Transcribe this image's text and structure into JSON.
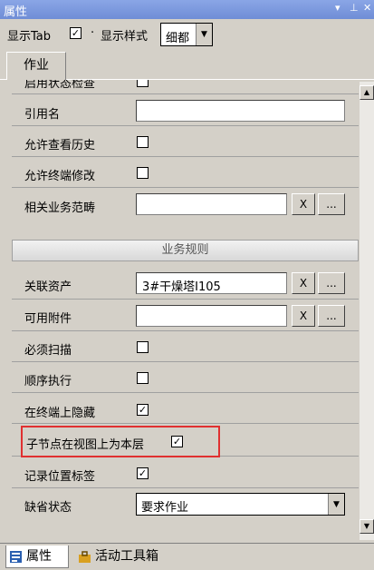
{
  "window": {
    "title": "属性",
    "controls": [
      "▾",
      "⊥",
      "✕"
    ]
  },
  "toolbar": {
    "show_tab_label": "显示Tab",
    "show_tab_checked": true,
    "separator": "·",
    "show_style_label": "显示样式",
    "style_value": "细都"
  },
  "tab": {
    "label": "作业"
  },
  "rows": {
    "r0": {
      "label": "启用状态检查",
      "checked": false
    },
    "r1": {
      "label": "引用名",
      "value": ""
    },
    "r2": {
      "label": "允许查看历史",
      "checked": false
    },
    "r3": {
      "label": "允许终端修改",
      "checked": false
    },
    "r4": {
      "label": "相关业务范畴",
      "value": ""
    }
  },
  "section": {
    "title": "业务规则"
  },
  "rules": {
    "r5": {
      "label": "关联资产",
      "value": "3#干燥塔I105"
    },
    "r6": {
      "label": "可用附件",
      "value": ""
    },
    "r7": {
      "label": "必须扫描",
      "checked": false
    },
    "r8": {
      "label": "顺序执行",
      "checked": false
    },
    "r9": {
      "label": "在终端上隐藏",
      "checked": true
    },
    "r10": {
      "label": "子节点在视图上为本层",
      "checked": true
    },
    "r11": {
      "label": "记录位置标签",
      "checked": true
    },
    "r12": {
      "label": "缺省状态",
      "value": "要求作业"
    }
  },
  "buttons": {
    "clear": "X",
    "browse": "..."
  },
  "bottom_tabs": [
    {
      "label": "属性",
      "icon": "properties-icon"
    },
    {
      "label": "活动工具箱",
      "icon": "toolbox-icon"
    }
  ],
  "colors": {
    "title_bg": "#7a96df",
    "highlight": "#e03030"
  }
}
